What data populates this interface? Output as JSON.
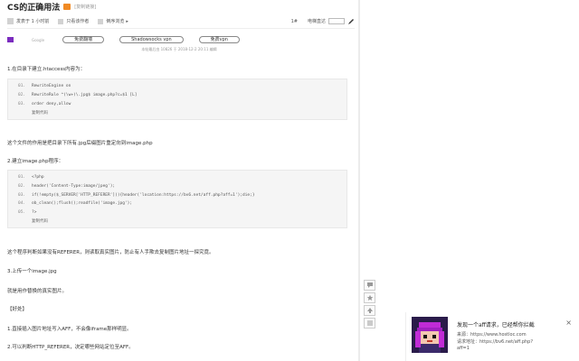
{
  "article": {
    "title": "CS的正确用法",
    "title_sub": "[复制链接]",
    "meta": {
      "checkbox_label": "发表于 1 小时前",
      "only_author": "只看该作者",
      "reverse": "倒序浏览",
      "reverse_arrow": "▸",
      "floor_mark": "1#",
      "go_floor": "电梯直达"
    },
    "ad": {
      "brand": "Google",
      "buttons": [
        "免费翻墙",
        "Shadowsocks vpn",
        "免费vpn"
      ]
    },
    "pubinfo": "本帖最后由 10826 于 2018-12-2 20:11 编辑",
    "p1": "1.在目录下建立.htaccess内容为：",
    "code1": {
      "lines": [
        {
          "n": "01.",
          "t": "RewriteEngine on"
        },
        {
          "n": "02.",
          "t": "RewriteRule ^(\\w+)\\.jpg$ image.php?c=$1 [L]"
        },
        {
          "n": "03.",
          "t": "order deny,allow"
        }
      ],
      "copy": "复制代码"
    },
    "p2": "这个文件的作用是把目录下所有.jpg后缀图片重定向到image.php",
    "p3": "2.建立image.php程序：",
    "code2": {
      "lines": [
        {
          "n": "01.",
          "t": "<?php"
        },
        {
          "n": "02.",
          "t": "header('Content-Type:image/jpeg');"
        },
        {
          "n": "03.",
          "t": "if(!empty($_SERVER['HTTP_REFERER'])){header('location:https://bv6.net/aff.php?aff=1');die;}"
        },
        {
          "n": "04.",
          "t": "ob_clean();flush();readfile('image.jpg');"
        },
        {
          "n": "05.",
          "t": "?>"
        }
      ],
      "copy": "复制代码"
    },
    "p4": "这个程序判断如果没有REFERER，则读取真实图片，防止有人手欺去复制图片地址一探究竟。",
    "p5": "3.上传一个image.jpg",
    "p6": "就是用作替换的真实图片。",
    "p7": "【好处】",
    "p8": "1.直接插入图片地址写入AFF，不会像iframe那样明显。",
    "p9": "2.可以判断HTTP_REFERER，决定哪些网站定位至AFF。"
  },
  "notification": {
    "title": "发现一个aff请求，已经帮你拦截",
    "source": "来源：https://www.hostloc.com",
    "url_label": "请求地址：https://bv6.net/aff.php?",
    "url_tail": "aff=1",
    "close": "×"
  },
  "colors": {
    "accent": "#f08a24",
    "ad_logo": "#7b2cbf"
  }
}
